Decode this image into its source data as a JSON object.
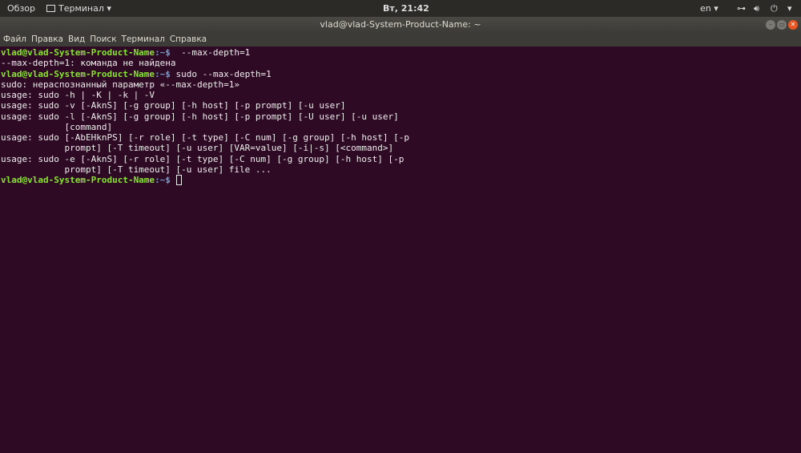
{
  "topbar": {
    "activities": "Обзор",
    "app_menu": "Терминал",
    "clock": "Вт, 21:42",
    "lang": "en"
  },
  "window": {
    "title": "vlad@vlad-System-Product-Name: ~"
  },
  "menu": [
    "Файл",
    "Правка",
    "Вид",
    "Поиск",
    "Терминал",
    "Справка"
  ],
  "terminal": {
    "prompt_user": "vlad@vlad-System-Product-Name",
    "prompt_path": ":~$",
    "lines": [
      {
        "prompt": true,
        "text": "  --max-depth=1"
      },
      {
        "prompt": false,
        "text": "--max-depth=1: команда не найдена"
      },
      {
        "prompt": true,
        "text": " sudo --max-depth=1"
      },
      {
        "prompt": false,
        "text": "sudo: нераспознанный параметр «--max-depth=1»"
      },
      {
        "prompt": false,
        "text": "usage: sudo -h | -K | -k | -V"
      },
      {
        "prompt": false,
        "text": "usage: sudo -v [-AknS] [-g group] [-h host] [-p prompt] [-u user]"
      },
      {
        "prompt": false,
        "text": "usage: sudo -l [-AknS] [-g group] [-h host] [-p prompt] [-U user] [-u user]"
      },
      {
        "prompt": false,
        "text": "            [command]"
      },
      {
        "prompt": false,
        "text": "usage: sudo [-AbEHknPS] [-r role] [-t type] [-C num] [-g group] [-h host] [-p"
      },
      {
        "prompt": false,
        "text": "            prompt] [-T timeout] [-u user] [VAR=value] [-i|-s] [<command>]"
      },
      {
        "prompt": false,
        "text": "usage: sudo -e [-AknS] [-r role] [-t type] [-C num] [-g group] [-h host] [-p"
      },
      {
        "prompt": false,
        "text": "            prompt] [-T timeout] [-u user] file ..."
      },
      {
        "prompt": true,
        "text": " ",
        "cursor": true
      }
    ]
  }
}
